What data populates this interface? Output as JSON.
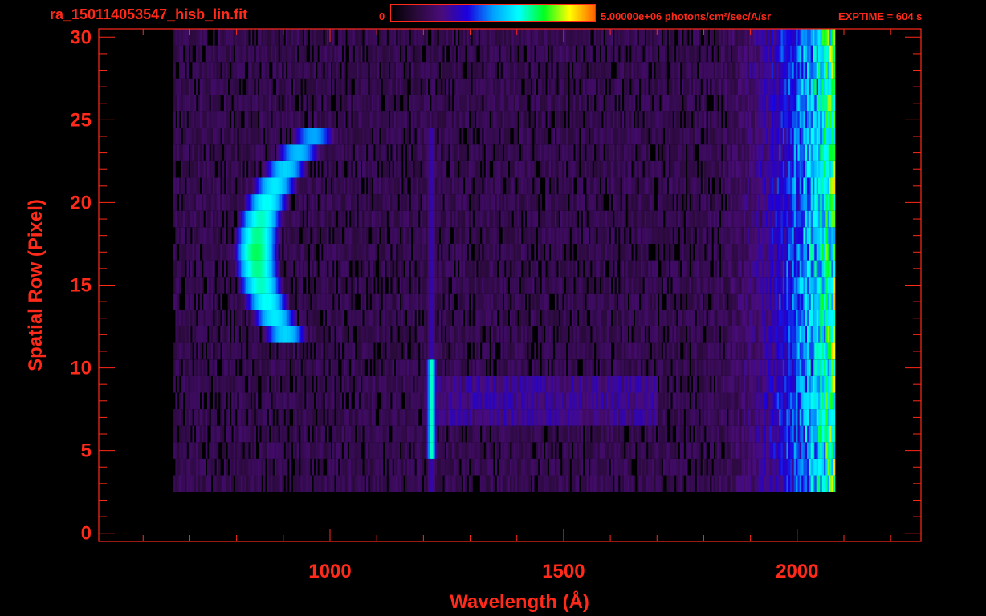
{
  "header": {
    "filename": "ra_150114053547_hisb_lin.fit",
    "colorbar_min_label": "0",
    "colorbar_max_label": "5.00000e+06 photons/cm²/sec/A/sr",
    "exptime_label": "EXPTIME = 604 s"
  },
  "colors": {
    "axis": "#ff2a1a",
    "background": "#000000",
    "colormap": [
      "#000000",
      "#2a0a3a",
      "#4a0c7a",
      "#1a00e0",
      "#00a0ff",
      "#00ffff",
      "#00ff20",
      "#ffff00",
      "#ff6000"
    ]
  },
  "chart_data": {
    "type": "heatmap",
    "xlabel": "Wavelength (Å)",
    "ylabel": "Spatial Row (Pixel)",
    "xlim": [
      505,
      2265
    ],
    "ylim": [
      -0.5,
      30.5
    ],
    "xticks": [
      1000,
      1500,
      2000
    ],
    "yticks": [
      0,
      5,
      10,
      15,
      20,
      25,
      30
    ],
    "xtick_labels": [
      "1000",
      "1500",
      "2000"
    ],
    "ytick_labels": [
      "0",
      "5",
      "10",
      "15",
      "20",
      "25",
      "30"
    ],
    "colorbar": {
      "min": 0,
      "max": 5000000,
      "unit": "photons/cm²/sec/A/sr"
    },
    "data_extent": {
      "x_start": 665,
      "x_end": 2080,
      "row_start": 3,
      "row_end": 30
    },
    "features": [
      {
        "type": "arc",
        "rows": [
          12,
          24
        ],
        "x_center_row": 17,
        "x_at_center": 840,
        "x_at_ends": 930,
        "width": 70,
        "peak_intensity": 0.72
      },
      {
        "type": "line",
        "x": 1215,
        "rows": [
          5,
          10
        ],
        "peak_intensity": 0.75
      },
      {
        "type": "line",
        "x": 1215,
        "rows": [
          3,
          24
        ],
        "peak_intensity": 0.35
      },
      {
        "type": "band",
        "rows": [
          7,
          9
        ],
        "x_range": [
          1215,
          1700
        ],
        "peak_intensity": 0.28
      },
      {
        "type": "red_continuum_rise",
        "x_range": [
          1800,
          2080
        ],
        "peak_intensity": 0.62
      }
    ]
  }
}
